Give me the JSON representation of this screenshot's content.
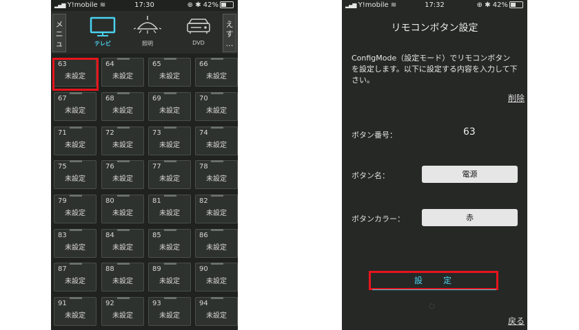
{
  "statusbar_left": {
    "carrier": "Y!mobile",
    "time": "17:30",
    "battery": "42%"
  },
  "statusbar_right": {
    "carrier": "Y!mobile",
    "time": "17:32",
    "battery": "42%"
  },
  "left": {
    "menu_label": "メニュー",
    "more_label": "えす…",
    "tabs": [
      {
        "label": "テレビ",
        "icon": "tv-icon",
        "active": true
      },
      {
        "label": "照明",
        "icon": "lamp-icon",
        "active": false
      },
      {
        "label": "DVD",
        "icon": "dvd-player-icon",
        "active": false
      }
    ],
    "buttons": [
      {
        "num": "63",
        "status": "未設定"
      },
      {
        "num": "64",
        "status": "未設定"
      },
      {
        "num": "65",
        "status": "未設定"
      },
      {
        "num": "66",
        "status": "未設定"
      },
      {
        "num": "67",
        "status": "未設定"
      },
      {
        "num": "68",
        "status": "未設定"
      },
      {
        "num": "69",
        "status": "未設定"
      },
      {
        "num": "70",
        "status": "未設定"
      },
      {
        "num": "71",
        "status": "未設定"
      },
      {
        "num": "72",
        "status": "未設定"
      },
      {
        "num": "73",
        "status": "未設定"
      },
      {
        "num": "74",
        "status": "未設定"
      },
      {
        "num": "75",
        "status": "未設定"
      },
      {
        "num": "76",
        "status": "未設定"
      },
      {
        "num": "77",
        "status": "未設定"
      },
      {
        "num": "78",
        "status": "未設定"
      },
      {
        "num": "79",
        "status": "未設定"
      },
      {
        "num": "80",
        "status": "未設定"
      },
      {
        "num": "81",
        "status": "未設定"
      },
      {
        "num": "82",
        "status": "未設定"
      },
      {
        "num": "83",
        "status": "未設定"
      },
      {
        "num": "84",
        "status": "未設定"
      },
      {
        "num": "85",
        "status": "未設定"
      },
      {
        "num": "86",
        "status": "未設定"
      },
      {
        "num": "87",
        "status": "未設定"
      },
      {
        "num": "88",
        "status": "未設定"
      },
      {
        "num": "89",
        "status": "未設定"
      },
      {
        "num": "90",
        "status": "未設定"
      },
      {
        "num": "91",
        "status": "未設定"
      },
      {
        "num": "92",
        "status": "未設定"
      },
      {
        "num": "93",
        "status": "未設定"
      },
      {
        "num": "94",
        "status": "未設定"
      }
    ]
  },
  "right": {
    "title": "リモコンボタン設定",
    "description": "ConfigMode（設定モード）でリモコンボタンを設定します。以下に設定する内容を入力して下さい。",
    "delete_link": "削除",
    "button_number_label": "ボタン番号：",
    "button_number_value": "63",
    "button_name_label": "ボタン名：",
    "button_name_value": "電源",
    "button_color_label": "ボタンカラー：",
    "button_color_value": "赤",
    "set_button_char1": "設",
    "set_button_char2": "定",
    "back_link": "戻る"
  },
  "colors": {
    "accent": "#4ad4f0",
    "highlight": "#e8141c"
  }
}
